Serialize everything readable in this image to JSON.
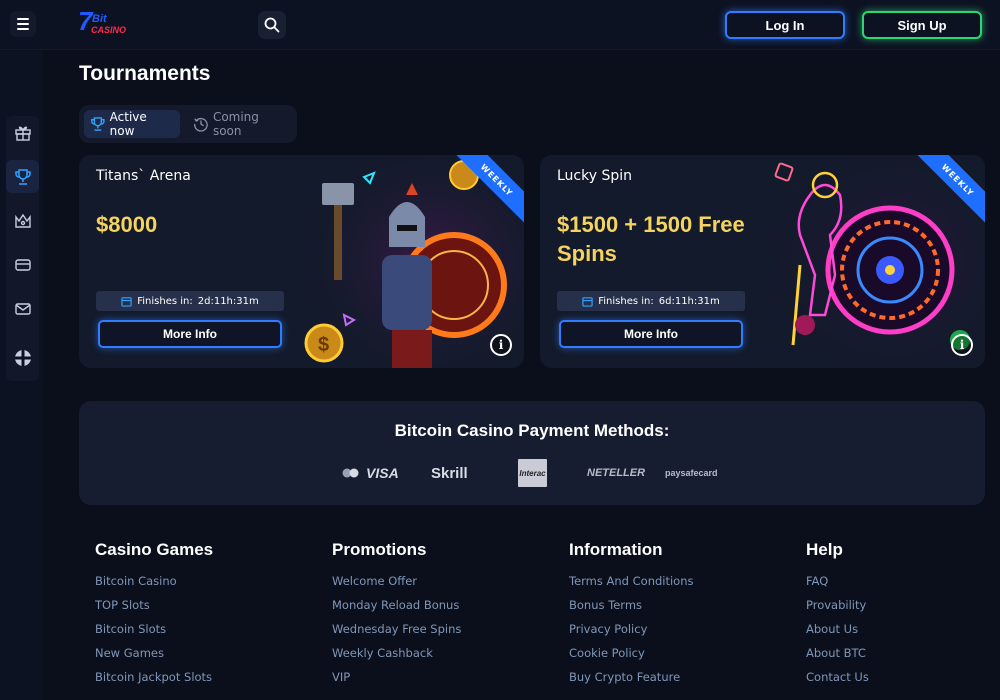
{
  "header": {
    "login_label": "Log In",
    "signup_label": "Sign Up"
  },
  "page_title": "Tournaments",
  "tabs": [
    {
      "label": "Active now",
      "active": true
    },
    {
      "label": "Coming soon",
      "active": false
    }
  ],
  "sidebar": {
    "items": [
      "gift-icon",
      "trophy-icon",
      "crown-icon",
      "card-icon",
      "mail-icon"
    ],
    "extra": "plus-cross-icon"
  },
  "tournaments": [
    {
      "title": "Titans` Arena",
      "prize": "$8000",
      "finishes_label": "Finishes in:",
      "finishes_time": "2d:11h:31m",
      "button": "More Info",
      "badge": "WEEKLY"
    },
    {
      "title": "Lucky Spin",
      "prize": "$1500 + 1500 Free Spins",
      "finishes_label": "Finishes in:",
      "finishes_time": "6d:11h:31m",
      "button": "More Info",
      "badge": "WEEKLY"
    }
  ],
  "payments": {
    "title": "Bitcoin Casino Payment Methods:",
    "methods": [
      "VISA",
      "Skrill",
      "Interac",
      "NETELLER",
      "paysafecard"
    ]
  },
  "footer": {
    "columns": [
      {
        "title": "Casino Games",
        "links": [
          "Bitcoin Casino",
          "TOP Slots",
          "Bitcoin Slots",
          "New Games",
          "Bitcoin Jackpot Slots"
        ]
      },
      {
        "title": "Promotions",
        "links": [
          "Welcome Offer",
          "Monday Reload Bonus",
          "Wednesday Free Spins",
          "Weekly Cashback",
          "VIP"
        ]
      },
      {
        "title": "Information",
        "links": [
          "Terms And Conditions",
          "Bonus Terms",
          "Privacy Policy",
          "Cookie Policy",
          "Buy Crypto Feature"
        ]
      },
      {
        "title": "Help",
        "links": [
          "FAQ",
          "Provability",
          "About Us",
          "About BTC",
          "Contact Us"
        ]
      }
    ]
  },
  "colors": {
    "background": "#0b0f1c",
    "card": "#131a2b",
    "accent_blue": "#2f7cff",
    "accent_green": "#2ed573",
    "prize_yellow": "#f4d35e",
    "link": "#7f97b8"
  }
}
